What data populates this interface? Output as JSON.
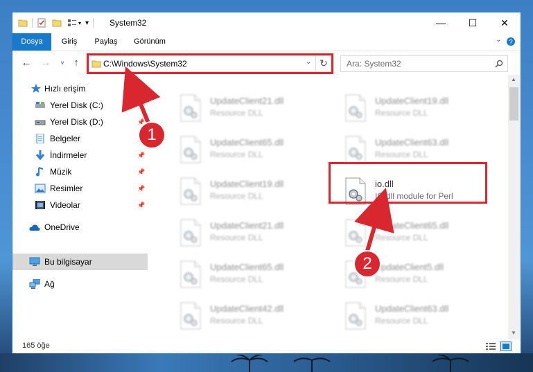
{
  "window": {
    "title": "System32",
    "tabs": [
      "Dosya",
      "Giriş",
      "Paylaş",
      "Görünüm"
    ]
  },
  "address": {
    "path": "C:\\Windows\\System32",
    "search_placeholder": "Ara: System32"
  },
  "sidebar": {
    "items": [
      {
        "label": "Hızlı erişim",
        "icon": "star-icon"
      },
      {
        "label": "Yerel Disk (C:)",
        "icon": "drive-icon"
      },
      {
        "label": "Yerel Disk (D:)",
        "icon": "drive-icon"
      },
      {
        "label": "Belgeler",
        "icon": "documents-icon"
      },
      {
        "label": "İndirmeler",
        "icon": "download-icon"
      },
      {
        "label": "Müzik",
        "icon": "music-icon"
      },
      {
        "label": "Resimler",
        "icon": "pictures-icon"
      },
      {
        "label": "Videolar",
        "icon": "video-icon"
      },
      {
        "label": "OneDrive",
        "icon": "cloud-icon"
      },
      {
        "label": "Bu bilgisayar",
        "icon": "computer-icon"
      },
      {
        "label": "Ağ",
        "icon": "network-icon"
      }
    ]
  },
  "files": [
    {
      "name": "UpdateClient21.dll",
      "desc": "Resource DLL"
    },
    {
      "name": "UpdateClient19.dll",
      "desc": "Resource DLL"
    },
    {
      "name": "UpdateClient65.dll",
      "desc": "Resource DLL"
    },
    {
      "name": "UpdateClient63.dll",
      "desc": "Resource DLL"
    },
    {
      "name": "UpdateClient19.dll",
      "desc": "Resource DLL"
    },
    {
      "name": "io.dll",
      "desc": "IO.dll module for Perl"
    },
    {
      "name": "UpdateClient21.dll",
      "desc": "Resource DLL"
    },
    {
      "name": "UpdateClient65.dll",
      "desc": "Resource DLL"
    },
    {
      "name": "UpdateClient65.dll",
      "desc": "Resource DLL"
    },
    {
      "name": "UpdateClient5.dll",
      "desc": "Resource DLL"
    },
    {
      "name": "UpdateClient42.dll",
      "desc": "Resource DLL"
    },
    {
      "name": "UpdateClient63.dll",
      "desc": "Resource DLL"
    }
  ],
  "status": {
    "count": "165 öğe"
  },
  "annotations": {
    "step1": "1",
    "step2": "2"
  },
  "colors": {
    "accent": "#1979ca",
    "highlight": "#d8272f"
  }
}
